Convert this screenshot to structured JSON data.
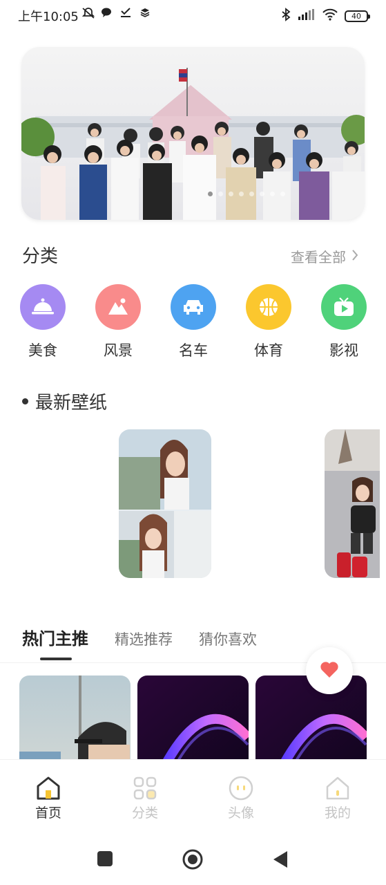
{
  "status_bar": {
    "time": "上午10:05",
    "battery": "40"
  },
  "banner": {
    "dot_count": 8,
    "active_dot": 0
  },
  "category_section": {
    "title": "分类",
    "view_all": "查看全部",
    "items": [
      {
        "label": "美食",
        "icon": "food-cloche-icon",
        "color": "#a58af2"
      },
      {
        "label": "风景",
        "icon": "landscape-icon",
        "color": "#f98b8b"
      },
      {
        "label": "名车",
        "icon": "car-icon",
        "color": "#4ea3f1"
      },
      {
        "label": "体育",
        "icon": "basketball-icon",
        "color": "#fbc72e"
      },
      {
        "label": "影视",
        "icon": "tv-play-icon",
        "color": "#4fd27a"
      }
    ]
  },
  "latest_section": {
    "title": "最新壁纸"
  },
  "tabs": {
    "items": [
      "热门主推",
      "精选推荐",
      "猜你喜欢"
    ],
    "active": 0
  },
  "bottom_nav": {
    "items": [
      {
        "label": "首页",
        "icon": "home-icon"
      },
      {
        "label": "分类",
        "icon": "grid-icon"
      },
      {
        "label": "头像",
        "icon": "avatar-face-icon"
      },
      {
        "label": "我的",
        "icon": "profile-house-icon"
      }
    ],
    "active": 0
  },
  "colors": {
    "accent_heart": "#f4645f",
    "nav_active_yellow": "#f6c431"
  }
}
